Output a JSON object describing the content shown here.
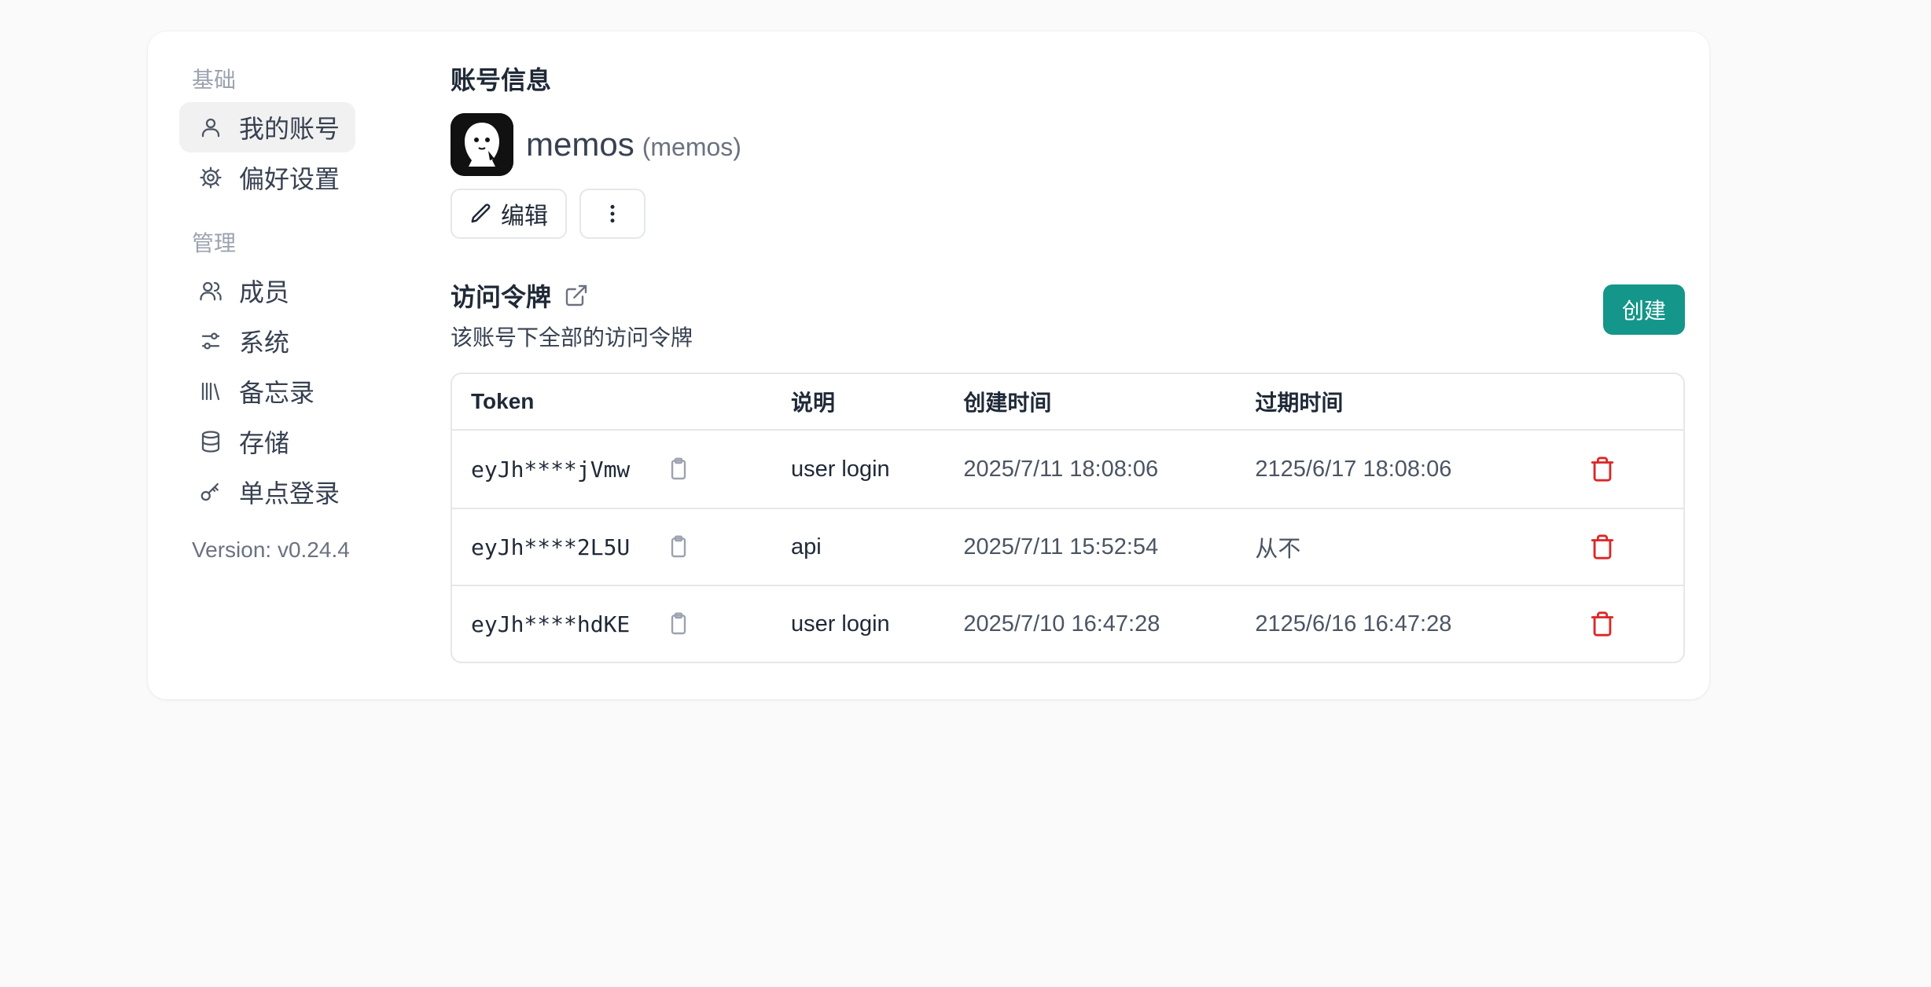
{
  "sidebar": {
    "section_basic": "基础",
    "section_admin": "管理",
    "items": [
      {
        "label": "我的账号",
        "icon": "user-icon"
      },
      {
        "label": "偏好设置",
        "icon": "gear-icon"
      },
      {
        "label": "成员",
        "icon": "users-icon"
      },
      {
        "label": "系统",
        "icon": "sliders-icon"
      },
      {
        "label": "备忘录",
        "icon": "library-icon"
      },
      {
        "label": "存储",
        "icon": "database-icon"
      },
      {
        "label": "单点登录",
        "icon": "key-icon"
      }
    ],
    "version": "Version: v0.24.4"
  },
  "account": {
    "title": "账号信息",
    "display_name": "memos",
    "username": "(memos)",
    "edit_label": "编辑"
  },
  "tokens": {
    "title": "访问令牌",
    "description": "该账号下全部的访问令牌",
    "create_label": "创建",
    "columns": [
      "Token",
      "说明",
      "创建时间",
      "过期时间"
    ],
    "rows": [
      {
        "token": "eyJh****jVmw",
        "description": "user login",
        "created": "2025/7/11 18:08:06",
        "expires": "2125/6/17 18:08:06"
      },
      {
        "token": "eyJh****2L5U",
        "description": "api",
        "created": "2025/7/11 15:52:54",
        "expires": "从不"
      },
      {
        "token": "eyJh****hdKE",
        "description": "user login",
        "created": "2025/7/10 16:47:28",
        "expires": "2125/6/16 16:47:28"
      }
    ]
  },
  "colors": {
    "accent": "#14968a",
    "danger": "#dc2626"
  }
}
